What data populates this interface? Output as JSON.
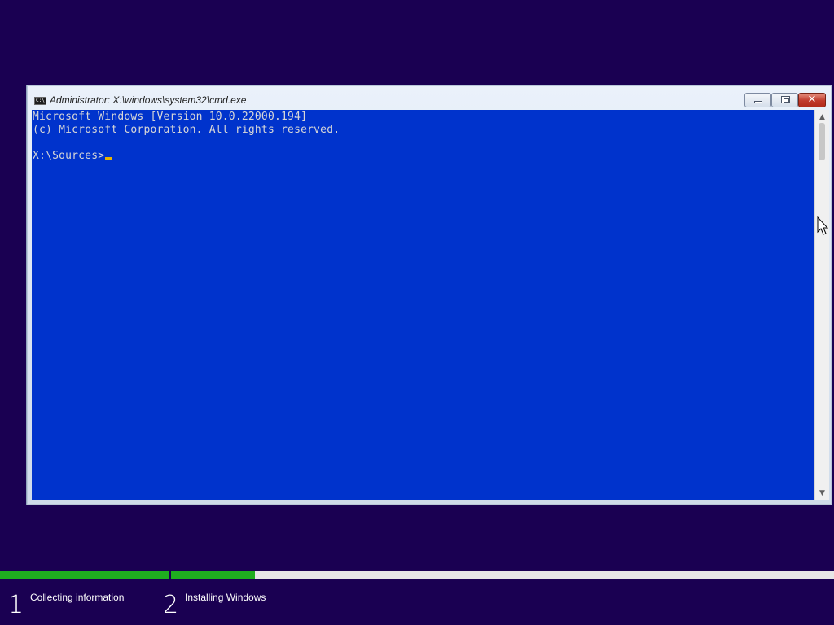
{
  "window": {
    "title": "Administrator: X:\\windows\\system32\\cmd.exe",
    "app_icon_text": "C:\\"
  },
  "console": {
    "lines": [
      "Microsoft Windows [Version 10.0.22000.194]",
      "(c) Microsoft Corporation. All rights reserved.",
      "",
      "X:\\Sources>"
    ],
    "background_color": "#0033cc",
    "text_color": "#d7d7d7",
    "cursor_color": "#e8b400"
  },
  "setup_progress": {
    "steps": [
      {
        "number": "1",
        "label": "Collecting information",
        "progress": 1.0
      },
      {
        "number": "2",
        "label": "Installing Windows",
        "progress": 0.126
      }
    ],
    "progress_color": "#1fae1f"
  },
  "icons": {
    "minimize": "minimize-icon",
    "maximize": "maximize-icon",
    "close": "close-icon",
    "pointer": "mouse-pointer-icon"
  }
}
